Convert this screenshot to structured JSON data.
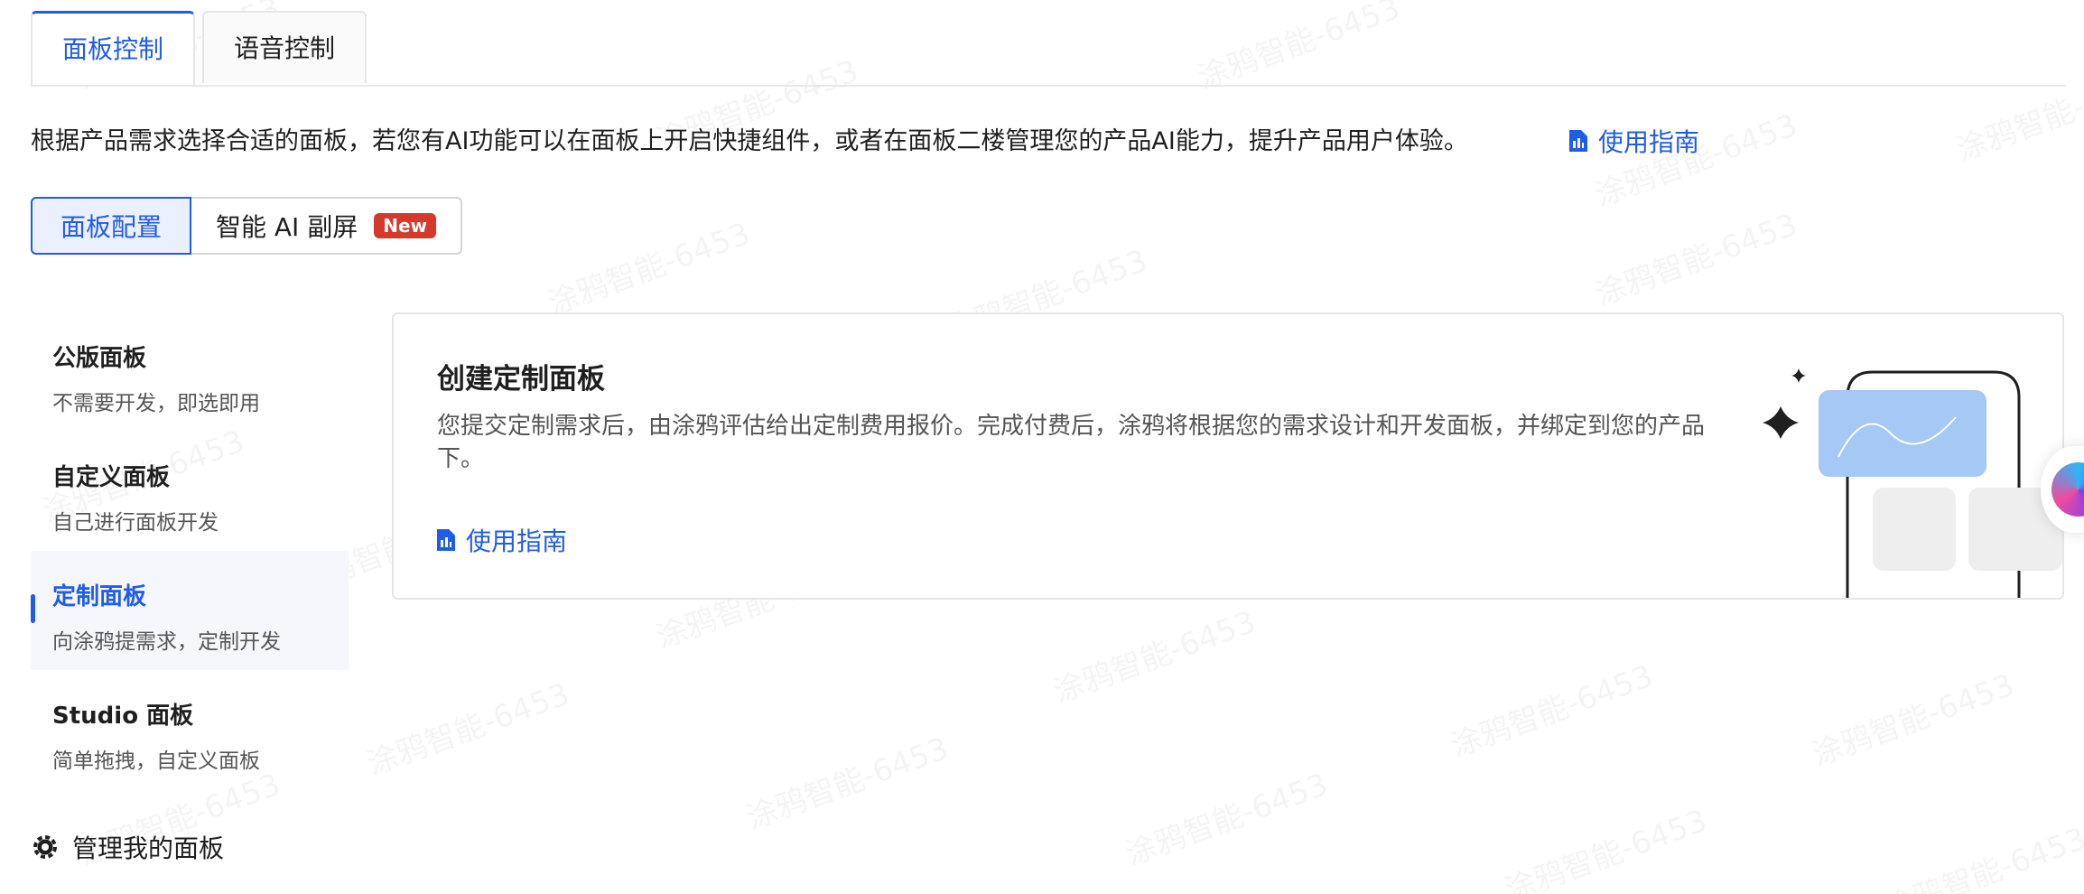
{
  "tabs": [
    {
      "label": "面板控制",
      "active": true
    },
    {
      "label": "语音控制",
      "active": false
    }
  ],
  "description": "根据产品需求选择合适的面板，若您有AI功能可以在面板上开启快捷组件，或者在面板二楼管理您的产品AI能力，提升产品用户体验。",
  "guide_link": "使用指南",
  "segment": {
    "config_label": "面板配置",
    "ai_label": "智能 AI 副屏",
    "new_badge": "New"
  },
  "menu": {
    "items": [
      {
        "title": "公版面板",
        "subtitle": "不需要开发，即选即用",
        "active": false
      },
      {
        "title": "自定义面板",
        "subtitle": "自己进行面板开发",
        "active": false
      },
      {
        "title": "定制面板",
        "subtitle": "向涂鸦提需求，定制开发",
        "active": true
      },
      {
        "title": "Studio 面板",
        "subtitle": "简单拖拽，自定义面板",
        "active": false
      }
    ]
  },
  "manage_label": "管理我的面板",
  "card": {
    "title": "创建定制面板",
    "description": "您提交定制需求后，由涂鸦评估给出定制费用报价。完成付费后，涂鸦将根据您的需求设计和开发面板，并绑定到您的产品下。",
    "guide_link": "使用指南"
  },
  "watermark_text": "涂鸦智能-6453",
  "colors": {
    "accent": "#1f5ce8",
    "badge": "#d33a2c"
  },
  "icons": {
    "guide": "document-chart-icon",
    "manage": "gear-icon",
    "illustration": "sparkle-phone-illustration"
  }
}
